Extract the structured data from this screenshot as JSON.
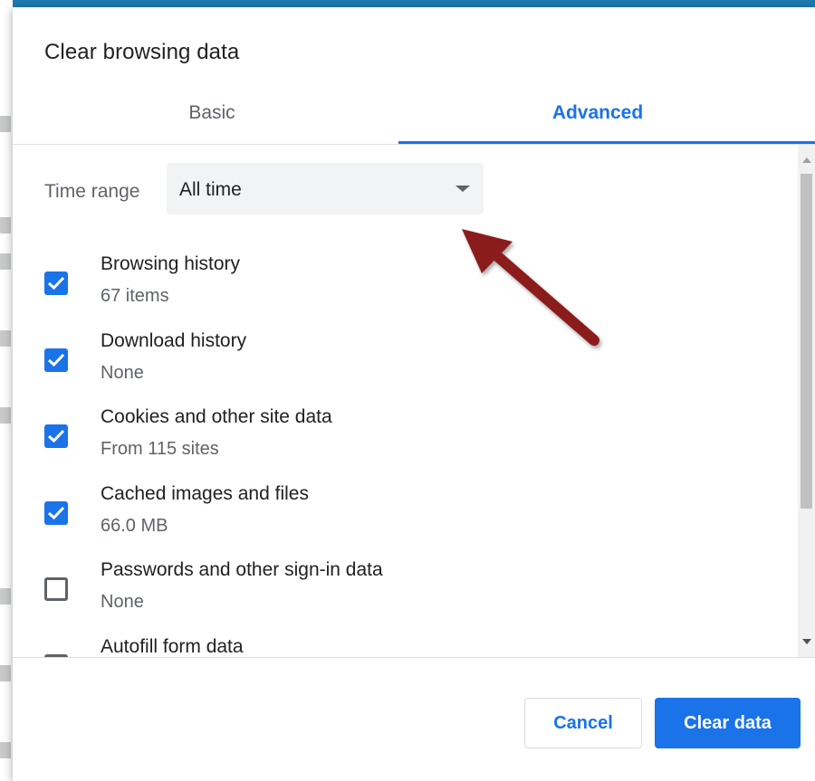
{
  "dialog": {
    "title": "Clear browsing data",
    "tabs": [
      {
        "label": "Basic",
        "selected": false
      },
      {
        "label": "Advanced",
        "selected": true
      }
    ]
  },
  "time_range": {
    "label": "Time range",
    "selected_value": "All time"
  },
  "items": [
    {
      "label": "Browsing history",
      "detail": "67 items",
      "checked": true
    },
    {
      "label": "Download history",
      "detail": "None",
      "checked": true
    },
    {
      "label": "Cookies and other site data",
      "detail": "From 115 sites",
      "checked": true
    },
    {
      "label": "Cached images and files",
      "detail": "66.0 MB",
      "checked": true
    },
    {
      "label": "Passwords and other sign-in data",
      "detail": "None",
      "checked": false
    },
    {
      "label": "Autofill form data",
      "detail": "",
      "checked": false
    }
  ],
  "buttons": {
    "cancel_label": "Cancel",
    "clear_label": "Clear data"
  },
  "colors": {
    "accent": "#1a73e8",
    "annotation_arrow": "#8b1a1a",
    "background": "#1e7bb3"
  }
}
